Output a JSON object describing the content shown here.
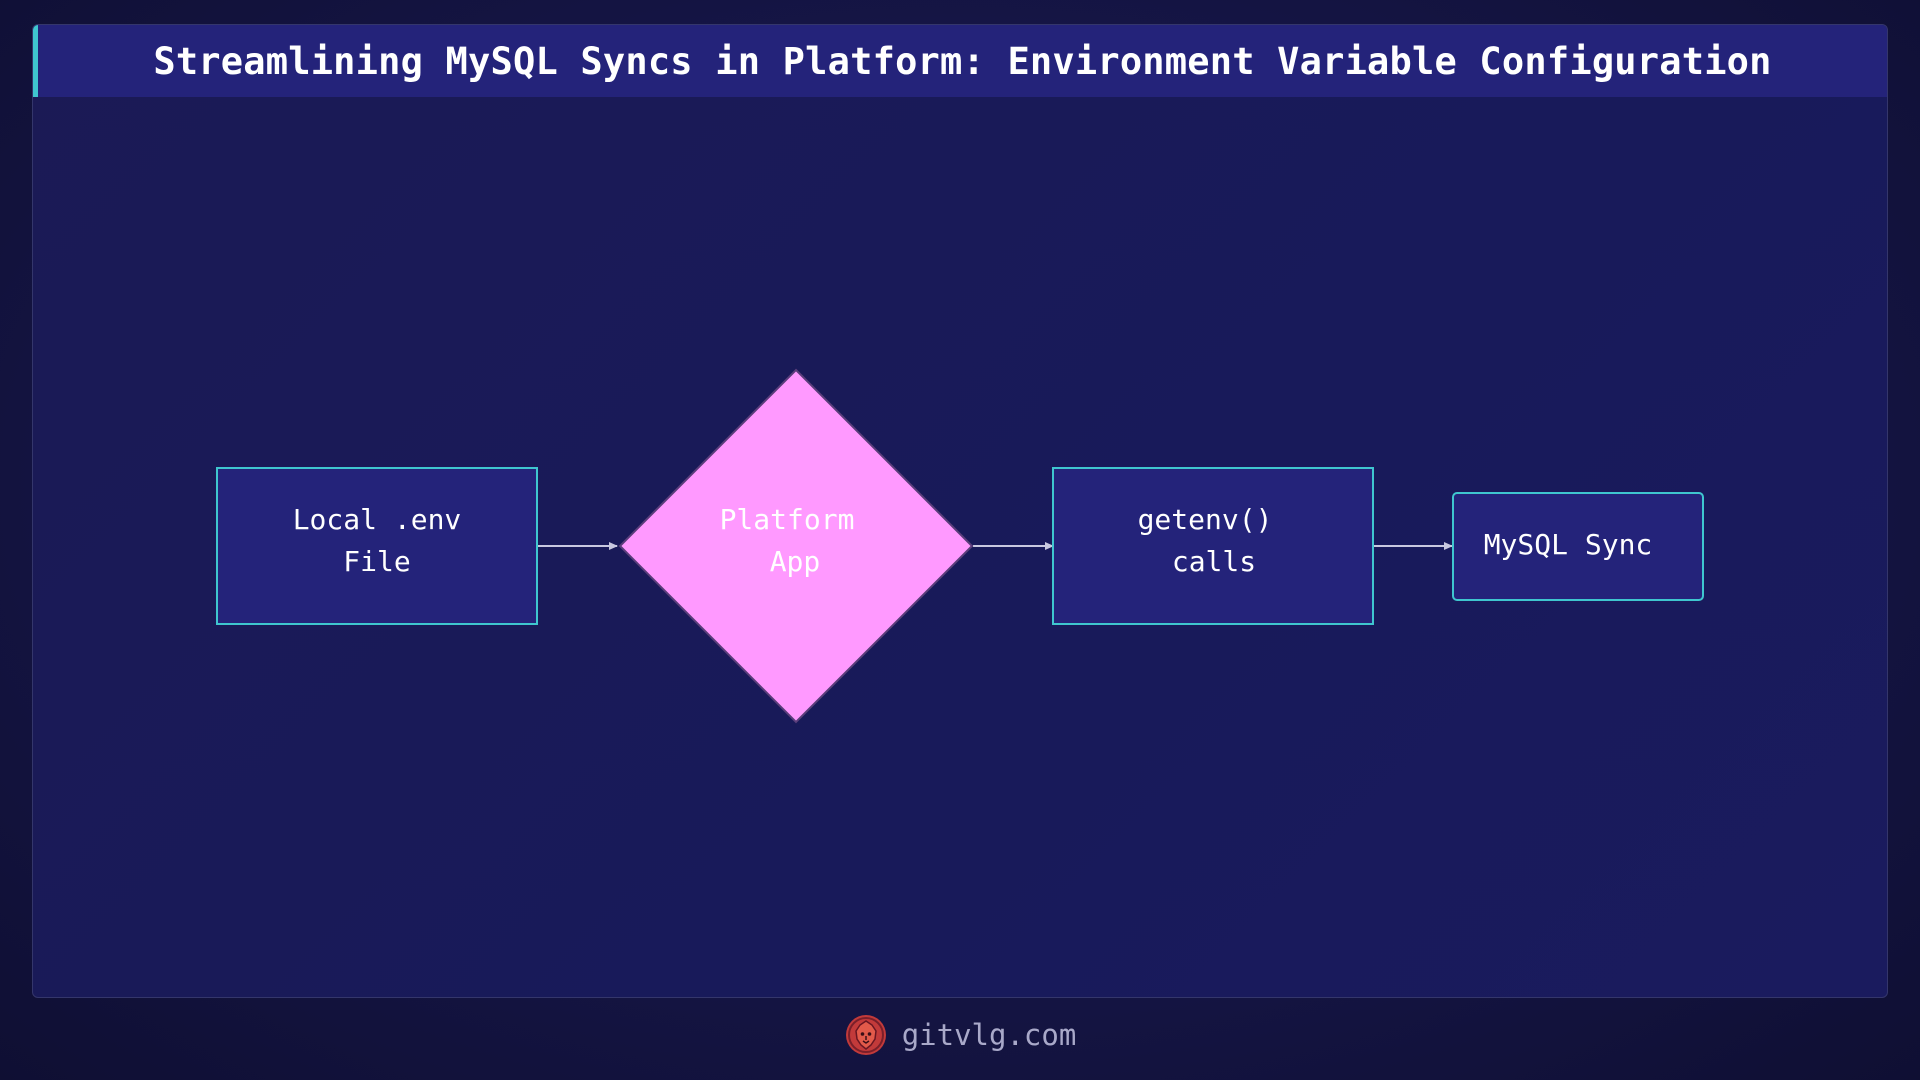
{
  "title": "Streamlining MySQL Syncs in Platform: Environment Variable Configuration",
  "colors": {
    "background": "#151545",
    "title_bar": "#24237a",
    "accent": "#3fc6cf",
    "box_fill": "#24237a",
    "box_border": "#3fc6cf",
    "decision_fill": "#ff99ff",
    "arrow": "#c8c8e0",
    "text": "#ffffff",
    "footer_text": "#a9a9c9"
  },
  "nodes": [
    {
      "id": "local-env",
      "shape": "rectangle",
      "lines": [
        "Local .env",
        "File"
      ]
    },
    {
      "id": "platform-app",
      "shape": "diamond",
      "lines": [
        "Platform",
        "App"
      ]
    },
    {
      "id": "getenv-calls",
      "shape": "rectangle",
      "lines": [
        "getenv()",
        "calls"
      ]
    },
    {
      "id": "mysql-sync",
      "shape": "rounded-rectangle",
      "lines": [
        "MySQL Sync"
      ]
    }
  ],
  "edges": [
    {
      "from": "local-env",
      "to": "platform-app"
    },
    {
      "from": "platform-app",
      "to": "getenv-calls"
    },
    {
      "from": "getenv-calls",
      "to": "mysql-sync"
    }
  ],
  "footer": {
    "logo_icon": "lion-logo-icon",
    "text": "gitvlg.com"
  }
}
